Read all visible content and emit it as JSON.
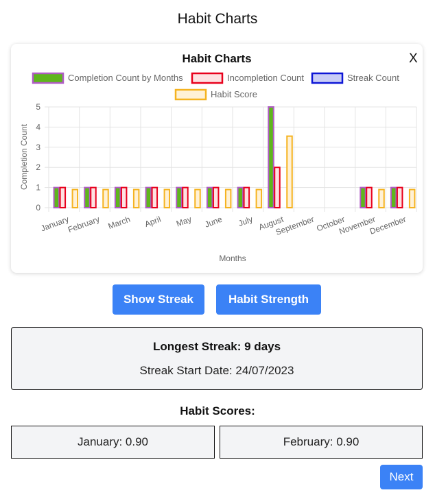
{
  "page": {
    "title": "Habit Charts"
  },
  "chart_card": {
    "close_label": "X"
  },
  "chart_data": {
    "type": "bar",
    "title": "Habit Charts",
    "xlabel": "Months",
    "ylabel": "Completion Count",
    "ylim": [
      0,
      5
    ],
    "yticks": [
      0,
      1,
      2,
      3,
      4,
      5
    ],
    "grid": true,
    "legend_position": "top",
    "categories": [
      "January",
      "February",
      "March",
      "April",
      "May",
      "June",
      "July",
      "August",
      "September",
      "October",
      "November",
      "December"
    ],
    "series": [
      {
        "name": "Completion Count by Months",
        "values": [
          1,
          1,
          1,
          1,
          1,
          1,
          1,
          5,
          0,
          0,
          1,
          1
        ],
        "fill": "#5fb61c",
        "stroke": "#b05cc5"
      },
      {
        "name": "Incompletion Count",
        "values": [
          1,
          1,
          1,
          1,
          1,
          1,
          1,
          2,
          0,
          0,
          1,
          1
        ],
        "fill": "#fde2e2",
        "stroke": "#e8001c"
      },
      {
        "name": "Streak Count",
        "values": [
          0,
          0,
          0,
          0,
          0,
          0,
          0,
          0,
          0,
          0,
          0,
          0
        ],
        "fill": "#c9cdf6",
        "stroke": "#0d16d6"
      },
      {
        "name": "Habit Score",
        "values": [
          0.9,
          0.9,
          0.9,
          0.9,
          0.9,
          0.9,
          0.9,
          3.55,
          0,
          0,
          0.9,
          0.9
        ],
        "fill": "#fff1d6",
        "stroke": "#f5b320"
      }
    ]
  },
  "buttons": {
    "show_streak": "Show Streak",
    "habit_strength": "Habit Strength",
    "next": "Next"
  },
  "streak": {
    "longest": "Longest Streak: 9 days",
    "start_date": "Streak Start Date: 24/07/2023"
  },
  "scores": {
    "title": "Habit Scores:",
    "items": [
      "January: 0.90",
      "February: 0.90"
    ]
  }
}
